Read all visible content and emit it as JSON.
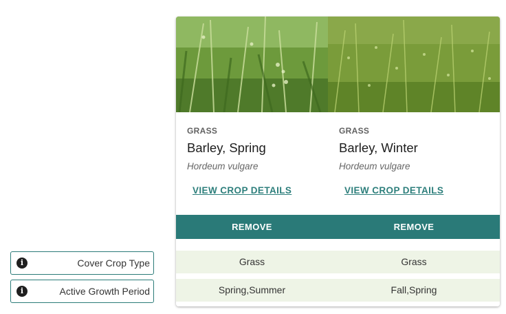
{
  "row_labels": [
    {
      "label": "Cover Crop Type",
      "icon": "info-icon"
    },
    {
      "label": "Active Growth Period",
      "icon": "info-icon"
    }
  ],
  "crops": [
    {
      "family": "GRASS",
      "name": "Barley, Spring",
      "scientific": "Hordeum vulgare",
      "details_label": "VIEW CROP DETAILS",
      "remove_label": "REMOVE",
      "cover_crop_type": "Grass",
      "active_growth_period": "Spring,Summer"
    },
    {
      "family": "GRASS",
      "name": "Barley, Winter",
      "scientific": "Hordeum vulgare",
      "details_label": "VIEW CROP DETAILS",
      "remove_label": "REMOVE",
      "cover_crop_type": "Grass",
      "active_growth_period": "Fall,Spring"
    }
  ],
  "colors": {
    "accent": "#2a7a78",
    "row_fill": "#eef4e6"
  }
}
